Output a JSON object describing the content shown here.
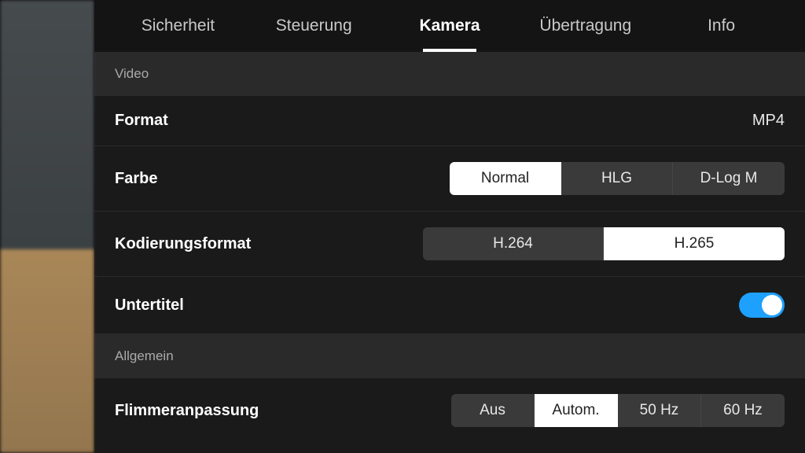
{
  "tabs": {
    "items": [
      "Sicherheit",
      "Steuerung",
      "Kamera",
      "Übertragung",
      "Info"
    ],
    "activeIndex": 2
  },
  "sections": {
    "video_header": "Video",
    "general_header": "Allgemein"
  },
  "video": {
    "format": {
      "label": "Format",
      "value": "MP4"
    },
    "color": {
      "label": "Farbe",
      "options": [
        "Normal",
        "HLG",
        "D-Log M"
      ],
      "selected": 0
    },
    "encoding": {
      "label": "Kodierungsformat",
      "options": [
        "H.264",
        "H.265"
      ],
      "selected": 1
    },
    "subtitles": {
      "label": "Untertitel",
      "on": true
    }
  },
  "general": {
    "flicker": {
      "label": "Flimmeranpassung",
      "options": [
        "Aus",
        "Autom.",
        "50 Hz",
        "60 Hz"
      ],
      "selected": 1
    }
  },
  "colors": {
    "accent": "#1ea0ff"
  }
}
